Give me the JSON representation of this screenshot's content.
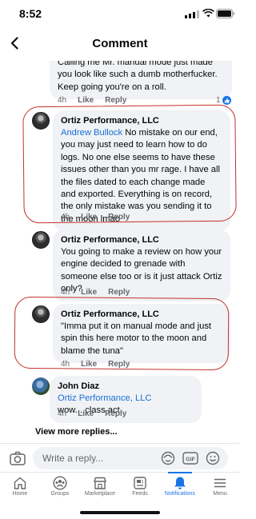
{
  "status_bar": {
    "time": "8:52"
  },
  "header": {
    "title": "Comment"
  },
  "comments": [
    {
      "text": "Calling me Mr. manual mode just made you look like such a dumb motherfucker. Keep going you're on a roll.",
      "time": "4h",
      "like": "Like",
      "reply": "Reply",
      "reactions": "1"
    },
    {
      "author": "Ortiz Performance, LLC",
      "mention": "Andrew Bullock",
      "text": " No mistake on our end, you may just need to learn how to do logs. No one else seems to have these issues other than you mr rage.  I have all the files dated to each change made and exported. Everything is on record, the only mistake was you sending it to the moon lmao",
      "time": "4h",
      "like": "Like",
      "reply": "Reply"
    },
    {
      "author": "Ortiz Performance, LLC",
      "text": "You going to make a review on how your engine decided to grenade with someone else too or is it just attack Ortiz only?",
      "time": "4h",
      "like": "Like",
      "reply": "Reply"
    },
    {
      "author": "Ortiz Performance, LLC",
      "text": "\"Imma put it on manual mode and just spin this here motor to the moon and blame the tuna\"",
      "time": "4h",
      "like": "Like",
      "reply": "Reply"
    },
    {
      "author": "John Diaz",
      "mention": "Ortiz Performance, LLC",
      "text": " wow....class act.",
      "time": "4h",
      "like": "Like",
      "reply": "Reply"
    }
  ],
  "view_more": "View more replies...",
  "reply_bar": {
    "placeholder": "Write a reply..."
  },
  "tabs": [
    {
      "label": "Home",
      "icon": "home-icon"
    },
    {
      "label": "Groups",
      "icon": "groups-icon"
    },
    {
      "label": "Marketplace",
      "icon": "marketplace-icon"
    },
    {
      "label": "Feeds",
      "icon": "feeds-icon"
    },
    {
      "label": "Notifications",
      "icon": "bell-icon",
      "active": true
    },
    {
      "label": "Menu",
      "icon": "menu-icon"
    }
  ],
  "colors": {
    "accent": "#1b74e4",
    "mention": "#1a6ed8",
    "annotation": "#c4322b",
    "bubble": "#f0f2f5"
  }
}
